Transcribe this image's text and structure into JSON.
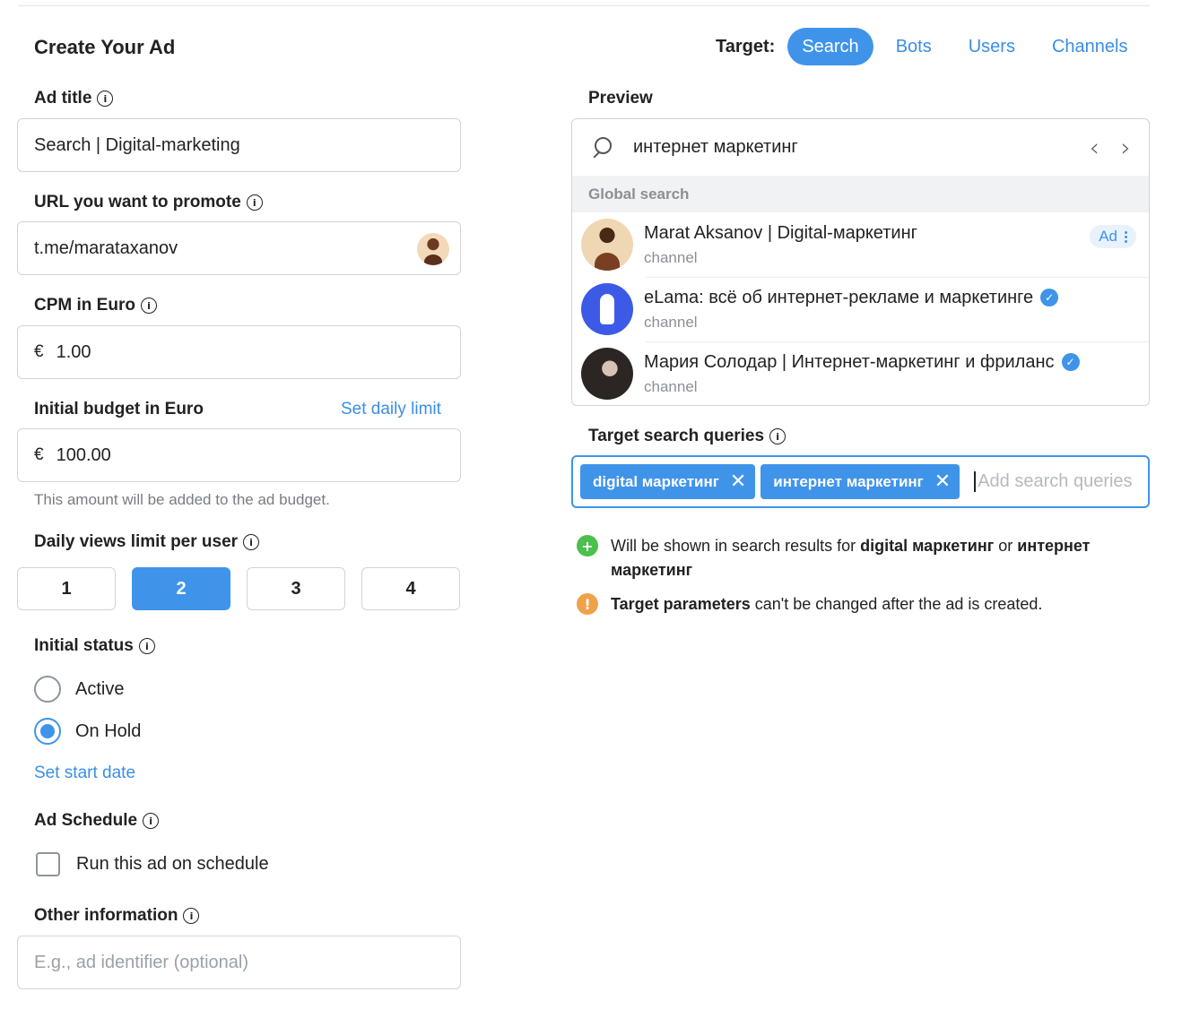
{
  "header": {
    "title": "Create Your Ad",
    "target_label": "Target:",
    "target_tabs": [
      {
        "label": "Search",
        "active": true
      },
      {
        "label": "Bots",
        "active": false
      },
      {
        "label": "Users",
        "active": false
      },
      {
        "label": "Channels",
        "active": false
      }
    ]
  },
  "form": {
    "ad_title": {
      "label": "Ad title",
      "value": "Search | Digital-marketing"
    },
    "url": {
      "label": "URL you want to promote",
      "value": "t.me/marataxanov"
    },
    "cpm": {
      "label": "CPM in Euro",
      "currency": "€",
      "value": "1.00"
    },
    "budget": {
      "label": "Initial budget in Euro",
      "link": "Set daily limit",
      "currency": "€",
      "value": "100.00",
      "hint": "This amount will be added to the ad budget."
    },
    "daily_views": {
      "label": "Daily views limit per user",
      "options": [
        "1",
        "2",
        "3",
        "4"
      ],
      "selected": "2"
    },
    "status": {
      "label": "Initial status",
      "options": [
        "Active",
        "On Hold"
      ],
      "selected": "On Hold",
      "start_date_link": "Set start date"
    },
    "schedule": {
      "label": "Ad Schedule",
      "checkbox_label": "Run this ad on schedule",
      "checked": false
    },
    "other": {
      "label": "Other information",
      "placeholder": "E.g., ad identifier (optional)"
    }
  },
  "preview": {
    "label": "Preview",
    "query": "интернет маркетинг",
    "section": "Global search",
    "results": [
      {
        "name": "Marat Aksanov | Digital-маркетинг",
        "sub": "channel",
        "badge": "Ad",
        "verified": false
      },
      {
        "name": "eLama: всё об интернет-рекламе и маркетинге",
        "sub": "channel",
        "verified": true
      },
      {
        "name": "Мария Солодар | Интернет-маркетинг и фриланс",
        "sub": "channel",
        "verified": true
      }
    ]
  },
  "target_queries": {
    "label": "Target search queries",
    "chips": [
      "digital маркетинг",
      "интернет маркетинг"
    ],
    "placeholder": "Add search queries",
    "note1_prefix": "Will be shown in search results for ",
    "note1_q1": "digital маркетинг",
    "note1_or": " or ",
    "note1_q2": "интернет маркетинг",
    "note2_bold": "Target parameters",
    "note2_rest": " can't be changed after the ad is created."
  },
  "colors": {
    "accent": "#3f94ea",
    "success": "#4cbf4c",
    "warning": "#f0a24a"
  },
  "icons": [
    "info-icon",
    "search-icon",
    "chevron-left-icon",
    "chevron-right-icon",
    "verified-icon",
    "close-icon",
    "plus-icon",
    "exclamation-icon",
    "more-vertical-icon"
  ]
}
